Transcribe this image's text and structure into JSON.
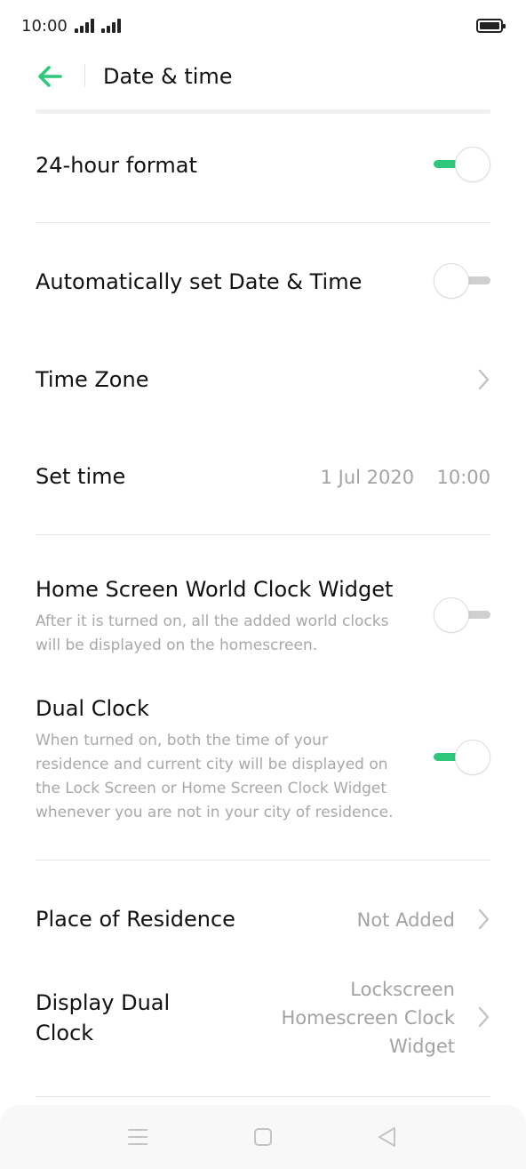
{
  "status_bar": {
    "time": "10:00"
  },
  "header": {
    "title": "Date & time"
  },
  "settings": {
    "hour24": {
      "label": "24-hour format",
      "enabled": true
    },
    "auto_datetime": {
      "label": "Automatically set Date & Time",
      "enabled": false
    },
    "time_zone": {
      "label": "Time Zone"
    },
    "set_time": {
      "label": "Set time",
      "date": "1 Jul 2020",
      "time": "10:00"
    },
    "world_clock_widget": {
      "label": "Home Screen World Clock Widget",
      "desc_lines": [
        "After it is turned on, all the added world clocks",
        "will be displayed on the homescreen."
      ],
      "enabled": false
    },
    "dual_clock": {
      "label": "Dual Clock",
      "desc_lines": [
        "When turned on, both the time of your",
        "residence and current city will be displayed on",
        "the Lock Screen or Home Screen Clock Widget",
        "whenever you are not in your city of residence."
      ],
      "enabled": true
    },
    "place_of_residence": {
      "label": "Place of Residence",
      "value": "Not Added"
    },
    "display_dual_clock": {
      "label_lines": [
        "Display Dual",
        "Clock"
      ],
      "value_lines": [
        "Lockscreen",
        "Homescreen Clock",
        "Widget"
      ]
    }
  },
  "colors": {
    "accent": "#2dc879",
    "toggle_off": "#cfcfcf"
  },
  "icons": {
    "back": "back-arrow-icon",
    "chevron": "chevron-right-icon",
    "nav_menu": "menu-icon",
    "nav_home": "home-square-icon",
    "nav_back": "back-triangle-icon"
  }
}
